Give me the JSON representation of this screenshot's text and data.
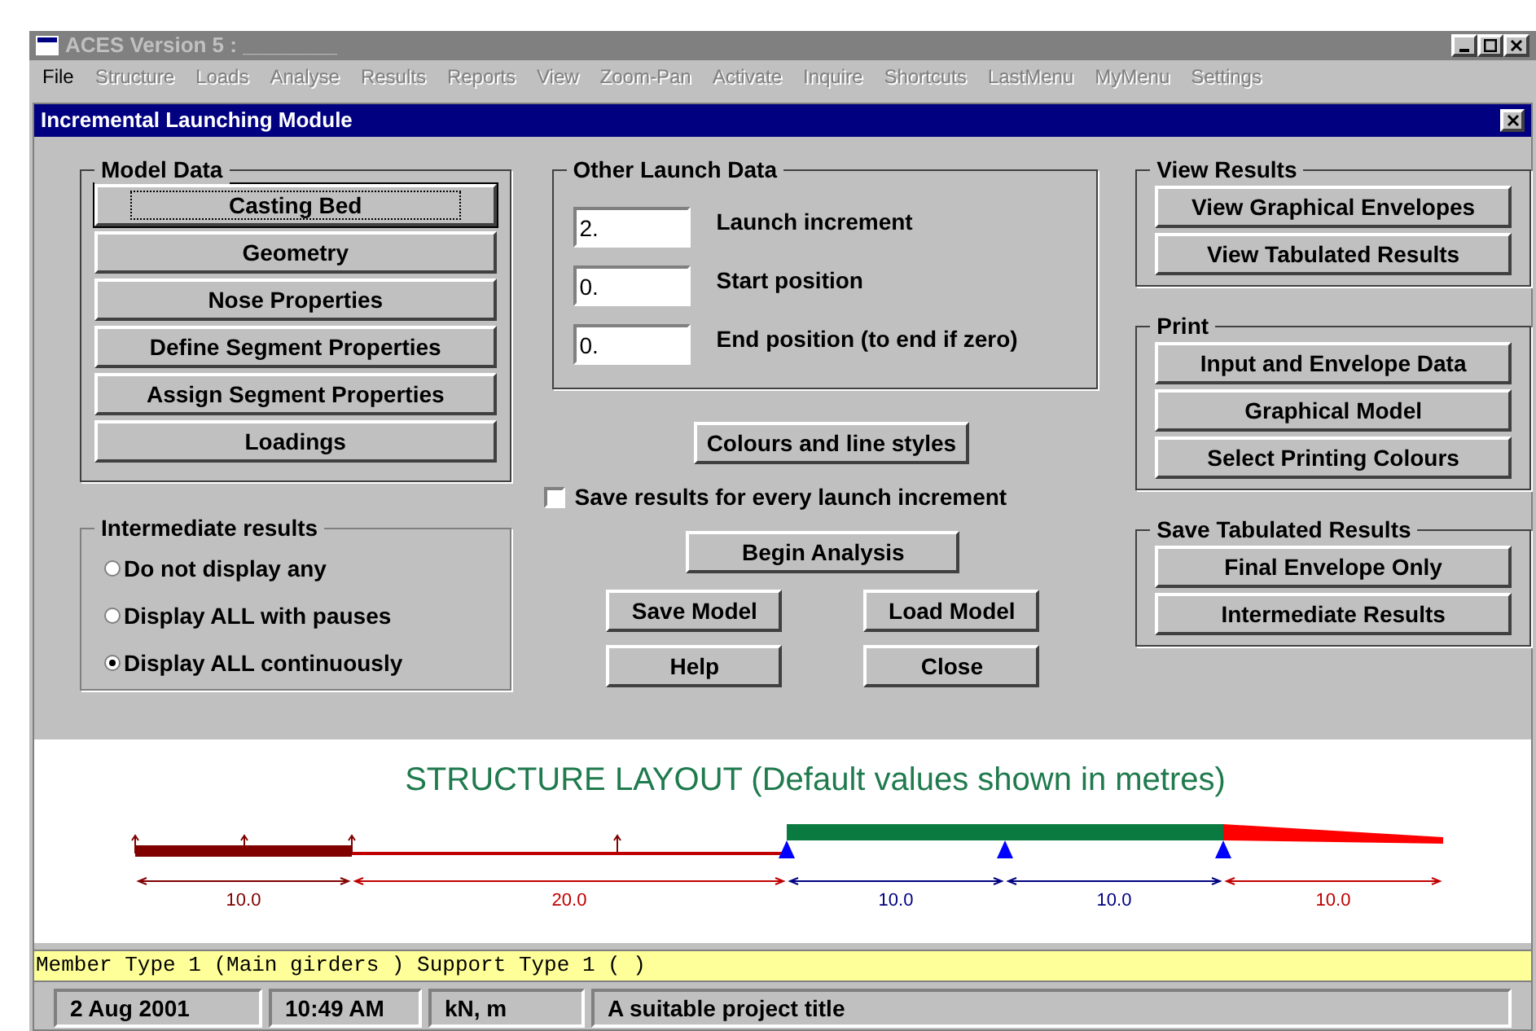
{
  "window": {
    "title": "ACES Version 5 : ________"
  },
  "menu": [
    {
      "label": "File",
      "disabled": false
    },
    {
      "label": "Structure",
      "disabled": true
    },
    {
      "label": "Loads",
      "disabled": true
    },
    {
      "label": "Analyse",
      "disabled": true
    },
    {
      "label": "Results",
      "disabled": true
    },
    {
      "label": "Reports",
      "disabled": true
    },
    {
      "label": "View",
      "disabled": true
    },
    {
      "label": "Zoom-Pan",
      "disabled": true
    },
    {
      "label": "Activate",
      "disabled": true
    },
    {
      "label": "Inquire",
      "disabled": true
    },
    {
      "label": "Shortcuts",
      "disabled": true
    },
    {
      "label": "LastMenu",
      "disabled": true
    },
    {
      "label": "MyMenu",
      "disabled": true
    },
    {
      "label": "Settings",
      "disabled": true
    }
  ],
  "dialog": {
    "title": "Incremental Launching Module",
    "model_data": {
      "title": "Model Data",
      "buttons": [
        {
          "label": "Casting Bed",
          "focused": true
        },
        {
          "label": "Geometry",
          "focused": false
        },
        {
          "label": "Nose Properties",
          "focused": false
        },
        {
          "label": "Define Segment Properties",
          "focused": false
        },
        {
          "label": "Assign Segment Properties",
          "focused": false
        },
        {
          "label": "Loadings",
          "focused": false
        }
      ]
    },
    "intermediate_results": {
      "title": "Intermediate results",
      "options": [
        {
          "label": "Do not display any",
          "selected": false
        },
        {
          "label": "Display ALL with pauses",
          "selected": false
        },
        {
          "label": "Display ALL continuously",
          "selected": true
        }
      ]
    },
    "other_launch_data": {
      "title": "Other Launch Data",
      "fields": [
        {
          "value": "2.",
          "label": "Launch increment"
        },
        {
          "value": "0.",
          "label": "Start position"
        },
        {
          "value": "0.",
          "label": "End position (to end if zero)"
        }
      ]
    },
    "colours_button": "Colours and line styles",
    "save_results": {
      "label": "Save results for every launch increment",
      "checked": false
    },
    "begin_button": "Begin Analysis",
    "action_buttons": [
      "Save Model",
      "Load Model",
      "Help",
      "Close"
    ],
    "groups": [
      {
        "title": "View Results",
        "buttons": [
          "View Graphical Envelopes",
          "View Tabulated Results"
        ]
      },
      {
        "title": "Print",
        "buttons": [
          "Input and Envelope Data",
          "Graphical Model",
          "Select Printing Colours"
        ]
      },
      {
        "title": "Save Tabulated Results",
        "buttons": [
          "Final Envelope Only",
          "Intermediate Results"
        ]
      }
    ]
  },
  "layout": {
    "title": "STRUCTURE LAYOUT (Default values shown in metres)",
    "spans": [
      {
        "label": "10.0",
        "color": "#800000"
      },
      {
        "label": "20.0",
        "color": "#c00000"
      },
      {
        "label": "10.0",
        "color": "#000080"
      },
      {
        "label": "10.0",
        "color": "#000080"
      },
      {
        "label": "10.0",
        "color": "#c00000"
      }
    ]
  },
  "info_bar": "Member Type 1 (Main girders ) Support Type 1 ( )",
  "status_bar": [
    "2 Aug 2001",
    "10:49 AM",
    "kN, m",
    "A suitable project title"
  ]
}
